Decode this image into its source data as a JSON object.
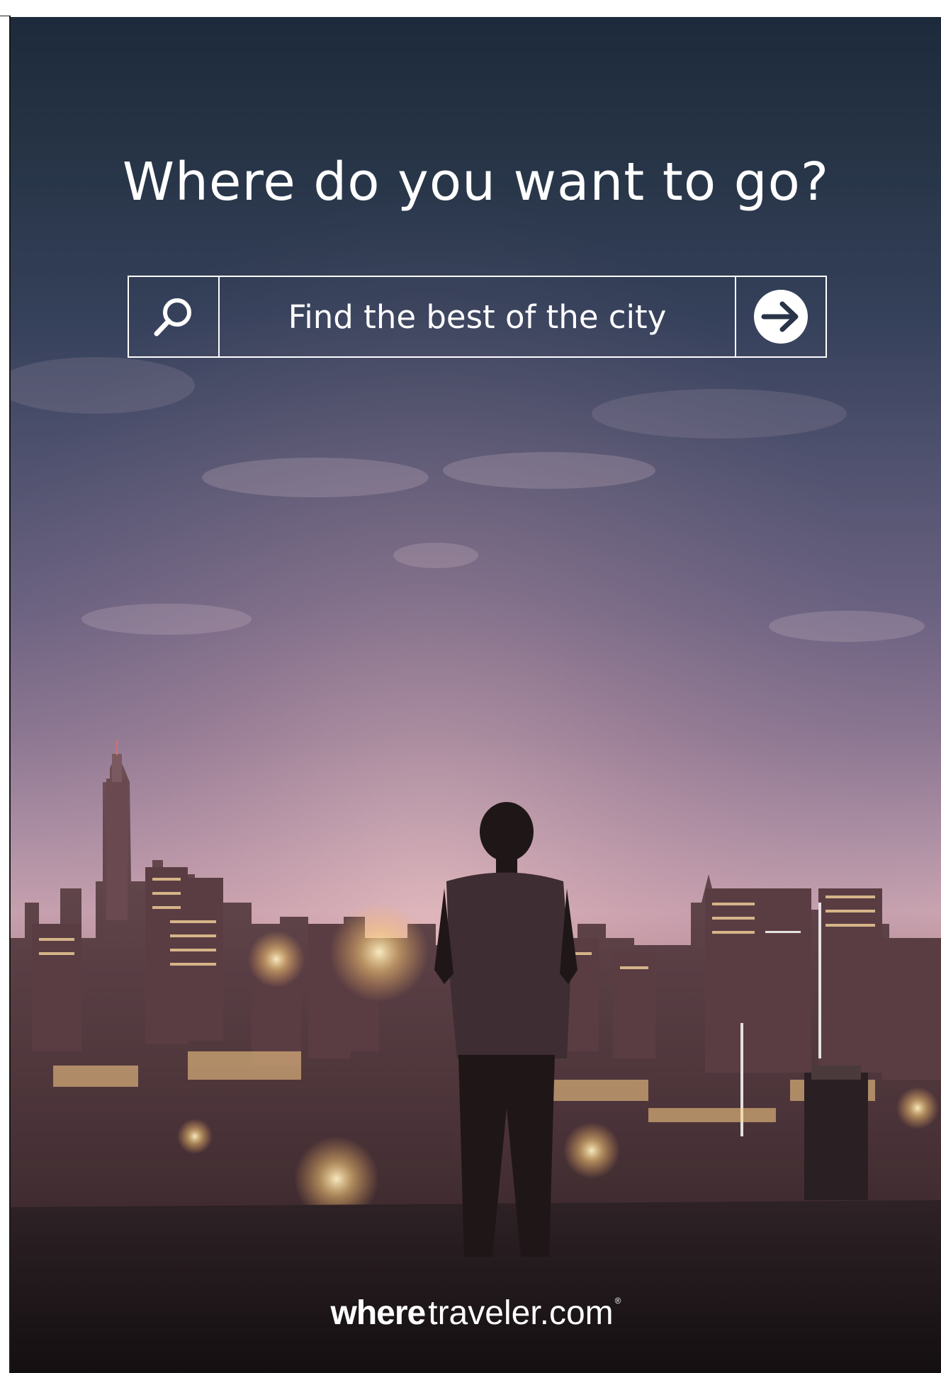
{
  "headline": "Where do you want to go?",
  "search": {
    "placeholder": "Find the best of the city",
    "search_icon": "search-icon",
    "go_icon": "arrow-right-circle-icon"
  },
  "brand": {
    "strong": "where",
    "light": "traveler.com",
    "reg": "®"
  },
  "colors": {
    "text": "#ffffff",
    "sky_top": "#1d2a3b",
    "sky_glow": "#c9a3b0",
    "ground": "#1a1416"
  }
}
